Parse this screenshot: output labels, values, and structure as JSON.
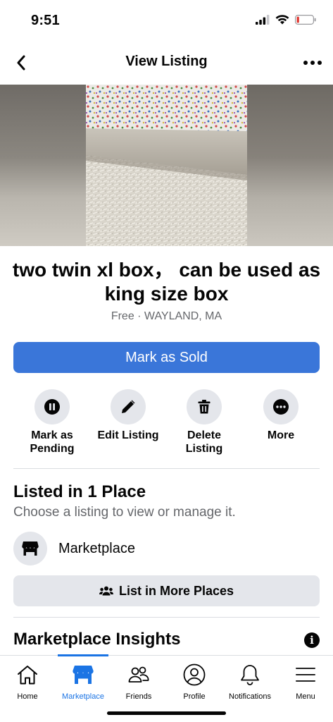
{
  "status": {
    "time": "9:51"
  },
  "nav": {
    "title": "View Listing"
  },
  "listing": {
    "title": "two twin xl box， can be used as king size box",
    "subtitle": "Free · WAYLAND, MA"
  },
  "primary_action": {
    "label": "Mark as Sold"
  },
  "actions": [
    {
      "label": "Mark as Pending",
      "icon": "pause-icon"
    },
    {
      "label": "Edit Listing",
      "icon": "pencil-icon"
    },
    {
      "label": "Delete Listing",
      "icon": "trash-icon"
    },
    {
      "label": "More",
      "icon": "more-icon"
    }
  ],
  "listed": {
    "title": "Listed in 1 Place",
    "subtitle": "Choose a listing to view or manage it.",
    "place": "Marketplace",
    "list_more_label": "List in More Places"
  },
  "insights": {
    "title": "Marketplace Insights"
  },
  "tabs": [
    {
      "label": "Home",
      "icon": "home-icon",
      "active": false
    },
    {
      "label": "Marketplace",
      "icon": "marketplace-icon",
      "active": true
    },
    {
      "label": "Friends",
      "icon": "friends-icon",
      "active": false
    },
    {
      "label": "Profile",
      "icon": "profile-icon",
      "active": false
    },
    {
      "label": "Notifications",
      "icon": "bell-icon",
      "active": false
    },
    {
      "label": "Menu",
      "icon": "menu-icon",
      "active": false
    }
  ],
  "colors": {
    "accent": "#1b74e4",
    "button_blue": "#3a76d9",
    "grey_button": "#e4e6eb",
    "secondary_text": "#65676b",
    "battery_low": "#e0342d"
  }
}
